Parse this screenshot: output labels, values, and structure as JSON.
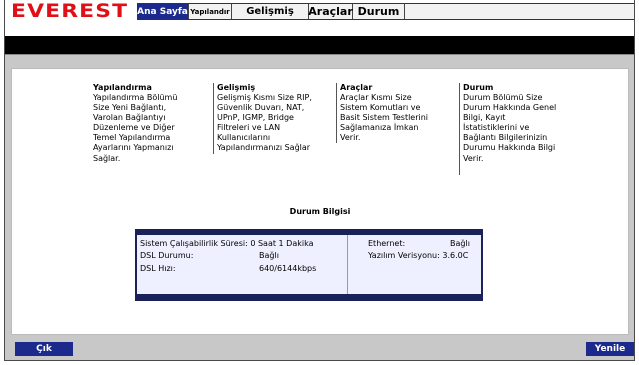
{
  "header": {
    "logo_text": "EVEREST",
    "tabs": [
      {
        "label": "Ana Sayfa",
        "active": true
      },
      {
        "label": "Yapılandır",
        "active": false
      },
      {
        "label": "Gelişmiş",
        "active": false
      },
      {
        "label": "Araçlar",
        "active": false
      },
      {
        "label": "Durum",
        "active": false
      }
    ]
  },
  "sections": [
    {
      "title": "Yapılandırma",
      "lines": [
        "Yapılandırma Bölümü",
        "Size Yeni Bağlantı,",
        "Varolan Bağlantıyı",
        "Düzenleme ve Diğer",
        "Temel Yapılandırma",
        "Ayarlarını Yapmanızı",
        "Sağlar."
      ]
    },
    {
      "title": "Gelişmiş",
      "lines": [
        "Gelişmiş Kısmı Size RIP,",
        "Güvenlik Duvarı, NAT,",
        "UPnP, IGMP, Bridge",
        "Filtreleri ve LAN",
        "Kullanıcılarını",
        "Yapılandırmanızı Sağlar"
      ]
    },
    {
      "title": "Araçlar",
      "lines": [
        "Araçlar Kısmı Size",
        "Sistem Komutları ve",
        "Basit Sistem Testlerini",
        "Sağlamanıza İmkan",
        "Verir."
      ]
    },
    {
      "title": "Durum",
      "lines": [
        "Durum Bölümü Size",
        "Durum Hakkında Genel",
        "Bilgi, Kayıt",
        "İstatistiklerini ve",
        "Bağlantı Bilgilerinizin",
        "Durumu Hakkında Bilgi",
        "Verir."
      ]
    }
  ],
  "status": {
    "title": "Durum Bilgisi",
    "uptime": "Sistem Çalışabilirlik Süresi: 0 Saat 1 Dakika",
    "dsl_status_label": "DSL Durumu:",
    "dsl_status_value": "Bağlı",
    "dsl_speed_label": "DSL Hızı:",
    "dsl_speed_value": "640/6144kbps",
    "ethernet_label": "Ethernet:",
    "ethernet_value": "Bağlı",
    "firmware": "Yazılım Verisyonu: 3.6.0C"
  },
  "footer": {
    "logout_label": "Çık",
    "refresh_label": "Yenile"
  },
  "colors": {
    "brand_red": "#e01018",
    "accent_blue": "#1b2a8c",
    "status_frame": "#1a2258"
  }
}
